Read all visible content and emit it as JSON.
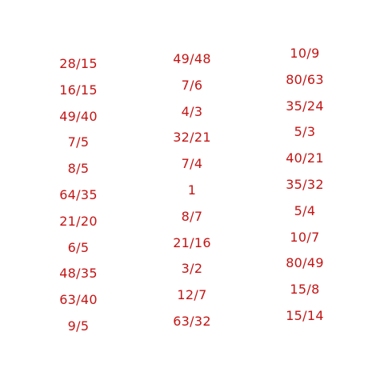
{
  "accent_color": "#c41414",
  "columns": [
    {
      "items": [
        "28/15",
        "16/15",
        "49/40",
        "7/5",
        "8/5",
        "64/35",
        "21/20",
        "6/5",
        "48/35",
        "63/40",
        "9/5"
      ]
    },
    {
      "items": [
        "49/48",
        "7/6",
        "4/3",
        "32/21",
        "7/4",
        "1",
        "8/7",
        "21/16",
        "3/2",
        "12/7",
        "63/32"
      ]
    },
    {
      "items": [
        "10/9",
        "80/63",
        "35/24",
        "5/3",
        "40/21",
        "35/32",
        "5/4",
        "10/7",
        "80/49",
        "15/8",
        "15/14"
      ]
    }
  ]
}
